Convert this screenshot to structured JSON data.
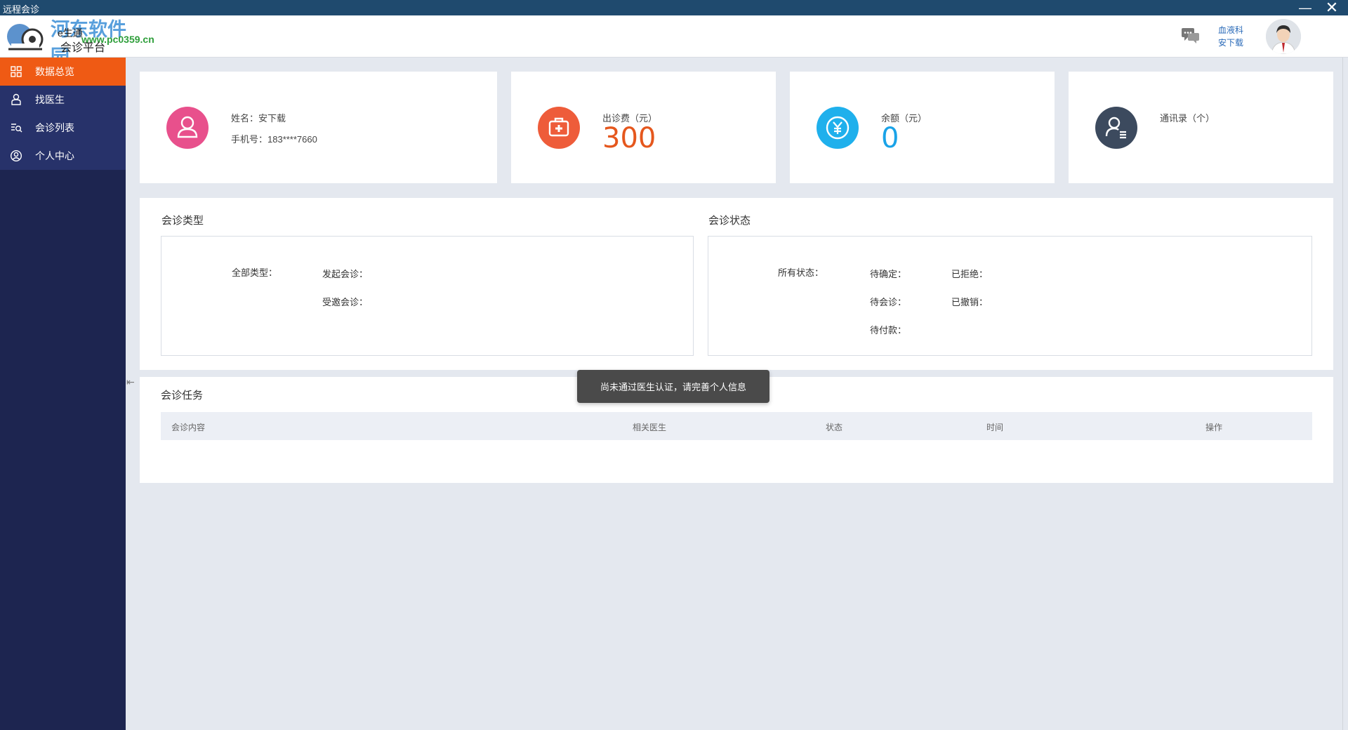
{
  "window": {
    "title": "远程会诊",
    "minimize": "—",
    "close": "✕"
  },
  "header": {
    "logo_line1": "e生通",
    "logo_line2": "会诊平台",
    "watermark": "河东软件园",
    "watermark_url": "www.pc0359.cn",
    "dept": "血液科",
    "user": "安下载",
    "chat_icon": "chat-bubbles-icon",
    "avatar_icon": "doctor-avatar"
  },
  "sidebar": {
    "items": [
      {
        "label": "数据总览",
        "icon": "grid-icon",
        "active": true
      },
      {
        "label": "找医生",
        "icon": "doctor-icon",
        "active": false
      },
      {
        "label": "会诊列表",
        "icon": "search-list-icon",
        "active": false
      },
      {
        "label": "个人中心",
        "icon": "user-circle-icon",
        "active": false
      }
    ],
    "collapse_glyph": "⇤"
  },
  "stats": {
    "profile": {
      "name": "姓名：安下载",
      "phone": "手机号：183****7660",
      "color": "#e8508c"
    },
    "fee": {
      "label": "出诊费（元）",
      "value": "300",
      "color": "#ee5c3a",
      "value_color": "#e5571d"
    },
    "balance": {
      "label": "余额（元）",
      "value": "0",
      "color": "#1fb0ec",
      "value_color": "#1aa3e8"
    },
    "contacts": {
      "label": "通讯录（个）",
      "color": "#3c4a5e"
    }
  },
  "consult_type": {
    "title": "会诊类型",
    "all": "全部类型：",
    "initiated": "发起会诊：",
    "invited": "受邀会诊："
  },
  "consult_status": {
    "title": "会诊状态",
    "all": "所有状态：",
    "pending_confirm": "待确定：",
    "pending_consult": "待会诊：",
    "pending_pay": "待付款：",
    "rejected": "已拒绝：",
    "cancelled": "已撤销："
  },
  "tasks": {
    "title": "会诊任务",
    "columns": [
      "会诊内容",
      "相关医生",
      "状态",
      "时间",
      "操作"
    ]
  },
  "toast": "尚未通过医生认证，请完善个人信息"
}
